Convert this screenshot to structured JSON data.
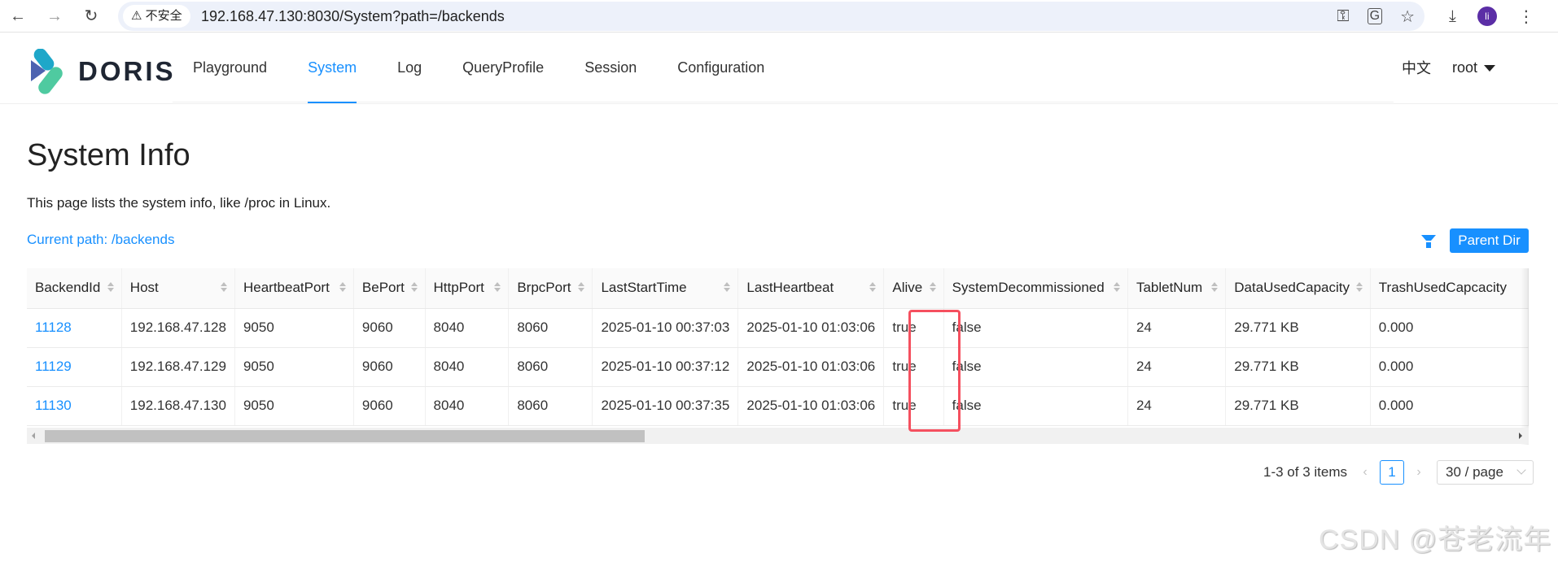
{
  "browser": {
    "security_label": "不安全",
    "url": "192.168.47.130:8030/System?path=/backends",
    "avatar_initial": "li"
  },
  "header": {
    "logo_text": "DORIS",
    "nav": [
      {
        "label": "Playground",
        "active": false
      },
      {
        "label": "System",
        "active": true
      },
      {
        "label": "Log",
        "active": false
      },
      {
        "label": "QueryProfile",
        "active": false
      },
      {
        "label": "Session",
        "active": false
      },
      {
        "label": "Configuration",
        "active": false
      }
    ],
    "language": "中文",
    "user": "root"
  },
  "page": {
    "title": "System Info",
    "description": "This page lists the system info, like /proc in Linux.",
    "current_path": "Current path: /backends",
    "parent_dir_label": "Parent Dir"
  },
  "table": {
    "columns": [
      "BackendId",
      "Host",
      "HeartbeatPort",
      "BePort",
      "HttpPort",
      "BrpcPort",
      "LastStartTime",
      "LastHeartbeat",
      "Alive",
      "SystemDecommissioned",
      "TabletNum",
      "DataUsedCapacity",
      "TrashUsedCapcacity"
    ],
    "rows": [
      [
        "11128",
        "192.168.47.128",
        "9050",
        "9060",
        "8040",
        "8060",
        "2025-01-10 00:37:03",
        "2025-01-10 01:03:06",
        "true",
        "false",
        "24",
        "29.771 KB",
        "0.000"
      ],
      [
        "11129",
        "192.168.47.129",
        "9050",
        "9060",
        "8040",
        "8060",
        "2025-01-10 00:37:12",
        "2025-01-10 01:03:06",
        "true",
        "false",
        "24",
        "29.771 KB",
        "0.000"
      ],
      [
        "11130",
        "192.168.47.130",
        "9050",
        "9060",
        "8040",
        "8060",
        "2025-01-10 00:37:35",
        "2025-01-10 01:03:06",
        "true",
        "false",
        "24",
        "29.771 KB",
        "0.000"
      ]
    ]
  },
  "pagination": {
    "total_text": "1-3 of 3 items",
    "current_page": "1",
    "page_size": "30 / page"
  },
  "watermark": "CSDN @苍老流年"
}
